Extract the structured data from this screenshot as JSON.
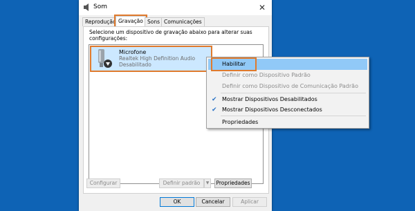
{
  "dialog": {
    "title": "Som",
    "close_glyph": "✕",
    "tabs": [
      {
        "label": "Reprodução"
      },
      {
        "label": "Gravação"
      },
      {
        "label": "Sons"
      },
      {
        "label": "Comunicações"
      }
    ],
    "description": "Selecione um dispositivo de gravação abaixo para alterar suas configurações:",
    "device": {
      "name": "Microfone",
      "driver": "Realtek High Definition Audio",
      "status": "Desabilitado"
    },
    "buttons": {
      "configure": "Configurar",
      "set_default": "Definir padrão",
      "dropdown_glyph": "▼",
      "properties": "Propriedades",
      "ok": "OK",
      "cancel": "Cancelar",
      "apply": "Aplicar"
    }
  },
  "context_menu": {
    "items": [
      {
        "label": "Habilitar"
      },
      {
        "label": "Definir como Dispositivo Padrão"
      },
      {
        "label": "Definir como Dispositivo de Comunicação Padrão"
      },
      {
        "label": "Mostrar Dispositivos Desabilitados",
        "check": "✔"
      },
      {
        "label": "Mostrar Dispositivos Desconectados",
        "check": "✔"
      },
      {
        "label": "Propriedades"
      }
    ]
  },
  "colors": {
    "desktop": "#0e63b5",
    "highlight_annotation": "#e07a2c",
    "selection": "#cce8ff",
    "menu_hover": "#91c9f7"
  }
}
